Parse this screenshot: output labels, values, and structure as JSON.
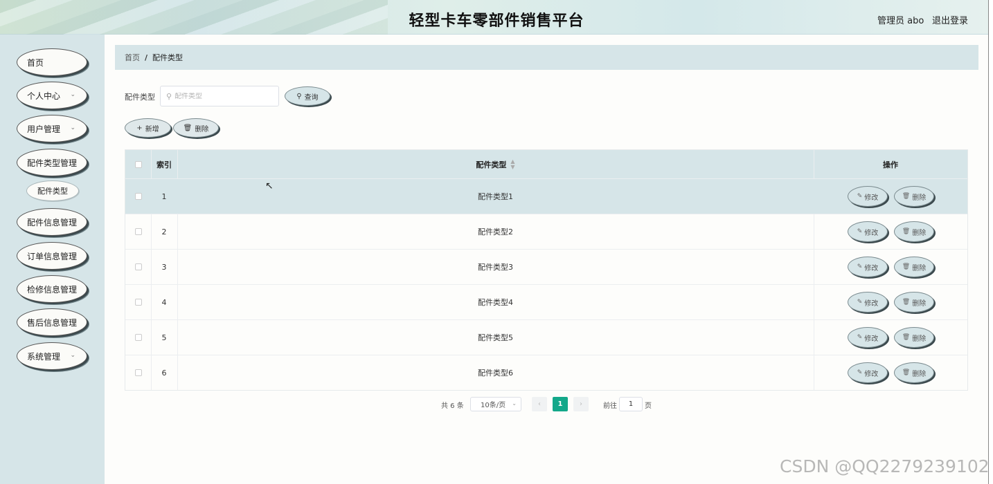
{
  "header": {
    "title": "轻型卡车零部件销售平台",
    "user": "管理员 abo",
    "logout": "退出登录"
  },
  "sidebar": {
    "items": [
      {
        "label": "首页",
        "has_children": false
      },
      {
        "label": "个人中心",
        "has_children": true
      },
      {
        "label": "用户管理",
        "has_children": true
      },
      {
        "label": "配件类型管理",
        "has_children": false
      },
      {
        "label": "配件信息管理",
        "has_children": false
      },
      {
        "label": "订单信息管理",
        "has_children": false
      },
      {
        "label": "检修信息管理",
        "has_children": false
      },
      {
        "label": "售后信息管理",
        "has_children": false
      },
      {
        "label": "系统管理",
        "has_children": true
      }
    ],
    "sub_item": "配件类型"
  },
  "breadcrumb": {
    "home": "首页",
    "separator": "/",
    "current": "配件类型"
  },
  "search": {
    "label": "配件类型",
    "placeholder": "配件类型",
    "value": "",
    "query_button": "查询"
  },
  "toolbar": {
    "add_label": "新增",
    "delete_label": "删除"
  },
  "table": {
    "headers": {
      "index": "索引",
      "type": "配件类型",
      "actions": "操作"
    },
    "rows": [
      {
        "index": "1",
        "type": "配件类型1"
      },
      {
        "index": "2",
        "type": "配件类型2"
      },
      {
        "index": "3",
        "type": "配件类型3"
      },
      {
        "index": "4",
        "type": "配件类型4"
      },
      {
        "index": "5",
        "type": "配件类型5"
      },
      {
        "index": "6",
        "type": "配件类型6"
      }
    ],
    "edit_label": "修改",
    "delete_label": "删除"
  },
  "pagination": {
    "total": "共 6 条",
    "page_size": "10条/页",
    "current_page": "1",
    "goto_label": "前往",
    "goto_value": "1",
    "page_suffix": "页"
  },
  "watermark": "CSDN @QQ2279239102",
  "colors": {
    "accent": "#13a88a",
    "panel": "#d6e5e8"
  }
}
